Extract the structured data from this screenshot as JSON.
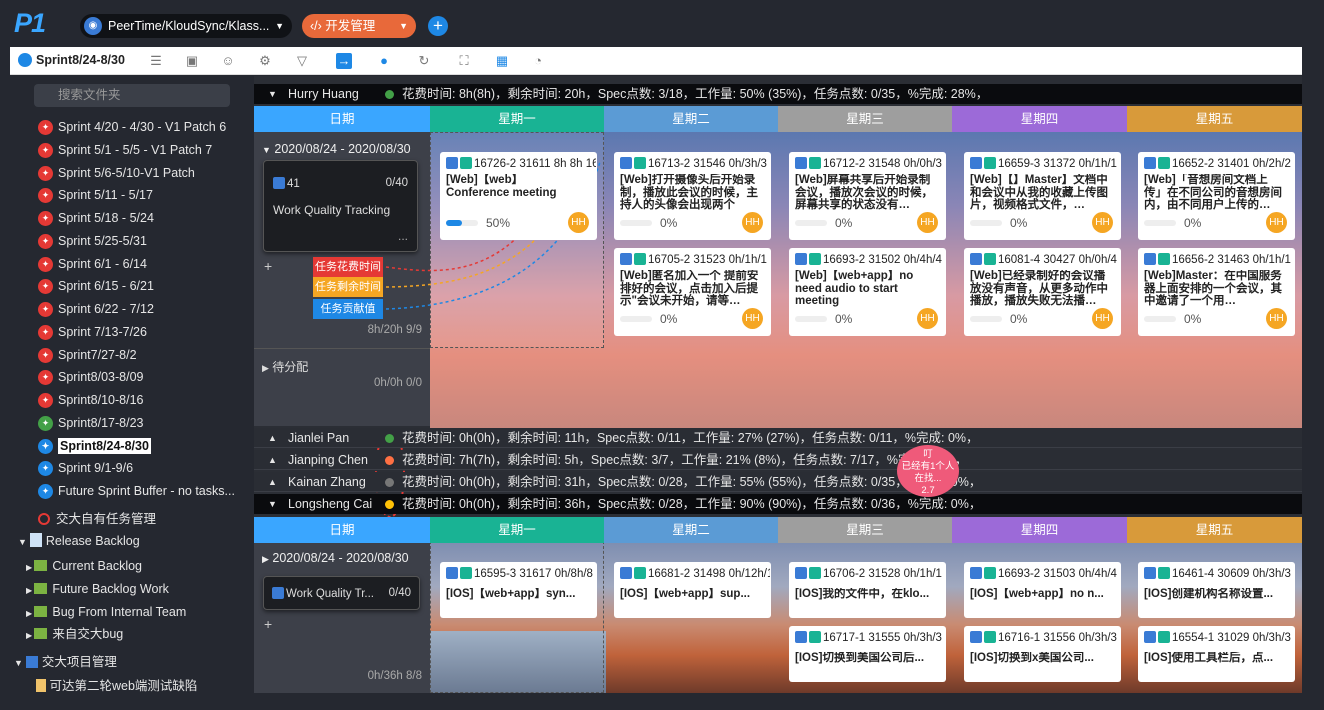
{
  "app": {
    "logo": "P1",
    "project": "PeerTime/KloudSync/Klass...",
    "module": "开发管理"
  },
  "toolbar": {
    "sprint": "Sprint8/24-8/30"
  },
  "sidebar": {
    "search_placeholder": "搜索文件夹",
    "sprints": [
      "Sprint 4/20 - 4/30 - V1 Patch 6",
      "Sprint 5/1 - 5/5 - V1 Patch 7",
      "Sprint 5/6-5/10-V1 Patch",
      "Sprint 5/11 - 5/17",
      "Sprint 5/18 - 5/24",
      "Sprint 5/25-5/31",
      "Sprint 6/1 - 6/14",
      "Sprint 6/15 - 6/21",
      "Sprint 6/22 - 7/12",
      "Sprint 7/13-7/26",
      "Sprint7/27-8/2",
      "Sprint8/03-8/09",
      "Sprint8/10-8/16",
      "Sprint8/17-8/23",
      "Sprint8/24-8/30",
      "Sprint 9/1-9/6",
      "Future Sprint Buffer - no tasks..."
    ],
    "own_tasks": "交大自有任务管理",
    "release_backlog": "Release Backlog",
    "backlog_items": [
      "Current Backlog",
      "Future Backlog Work",
      "Bug From Internal Team",
      "来自交大bug"
    ],
    "project_mgmt": "交大项目管理",
    "doc_item": "可达第二轮web端测试缺陷"
  },
  "users": [
    {
      "name": "Hurry Huang",
      "stats": "花费时间: 8h(8h)，剩余时间: 20h，Spec点数: 3/18，工作量: 50% (35%)，任务点数: 0/35，%完成: 28%，"
    },
    {
      "name": "Jianlei Pan",
      "stats": "花费时间: 0h(0h)，剩余时间: 11h，Spec点数: 0/11，工作量: 27% (27%)，任务点数: 0/11，%完成: 0%，"
    },
    {
      "name": "Jianping Chen",
      "stats": "花费时间: 7h(7h)，剩余时间: 5h，Spec点数: 3/7，工作量: 21% (8%)，任务点数: 7/17，%完成: 41%，"
    },
    {
      "name": "Kainan Zhang",
      "stats": "花费时间: 0h(0h)，剩余时间: 31h，Spec点数: 0/28，工作量: 55% (55%)，任务点数: 0/35，%完成: 0%，"
    },
    {
      "name": "Longsheng Cai",
      "stats": "花费时间: 0h(0h)，剩余时间: 36h，Spec点数: 0/28，工作量: 90% (90%)，任务点数: 0/36，%完成: 0%，"
    }
  ],
  "days": [
    "日期",
    "星期一",
    "星期二",
    "星期三",
    "星期四",
    "星期五"
  ],
  "group1": {
    "range": "2020/08/24 - 2020/08/30",
    "quality": {
      "id": "41",
      "count": "0/40",
      "title": "Work Quality Tracking",
      "more": "..."
    },
    "footer": "8h/20h  9/9",
    "unassigned": "待分配",
    "unassigned_footer": "0h/0h  0/0"
  },
  "tags": [
    "任务花费时间",
    "任务剩余时间",
    "任务贡献值"
  ],
  "cards1": [
    {
      "hd": "16726-2 31611 8h 8h 16",
      "ti": "[Web]【web】Conference meeting",
      "pc": "50%"
    },
    {
      "hd": "16713-2 31546 0h/3h/3",
      "ti": "[Web]打开摄像头后开始录制，播放此会议的时候，主持人的头像会出现两个",
      "pc": "0%"
    },
    {
      "hd": "16712-2 31548 0h/0h/3",
      "ti": "[Web]屏幕共享后开始录制会议，播放次会议的时候，屏幕共享的状态没有…",
      "pc": "0%"
    },
    {
      "hd": "16659-3 31372 0h/1h/1",
      "ti": "[Web]【】Master】文档中和会议中从我的收藏上传图片，视频格式文件，…",
      "pc": "0%"
    },
    {
      "hd": "16652-2 31401 0h/2h/2",
      "ti": "[Web]「音想房间文档上传」在不同公司的音想房间内，由不同用户上传的…",
      "pc": "0%"
    },
    {
      "hd": "16705-2 31523 0h/1h/1",
      "ti": "[Web]匿名加入一个 提前安排好的会议，点击加入后提示\"会议未开始，请等…",
      "pc": "0%"
    },
    {
      "hd": "16693-2 31502 0h/4h/4",
      "ti": "[Web]【web+app】no need audio to start meeting",
      "pc": "0%"
    },
    {
      "hd": "16081-4 30427 0h/0h/4",
      "ti": "[Web]已经录制好的会议播放没有声音，从更多动作中播放，播放失败无法播…",
      "pc": "0%"
    },
    {
      "hd": "16656-2 31463 0h/1h/1",
      "ti": "[Web]Master：在中国服务器上面安排的一个会议，其中邀请了一个用…",
      "pc": "0%"
    }
  ],
  "assignee_initials": "HH",
  "group2": {
    "range": "2020/08/24 - 2020/08/30",
    "quality": {
      "title": "Work Quality Tr...",
      "count": "0/40"
    },
    "footer": "0h/36h  8/8"
  },
  "cards2": [
    {
      "hd": "16595-3 31617 0h/8h/8",
      "ti": "[IOS]【web+app】syn..."
    },
    {
      "hd": "16681-2 31498 0h/12h/12",
      "ti": "[IOS]【web+app】sup..."
    },
    {
      "hd": "16706-2 31528 0h/1h/1",
      "ti": "[IOS]我的文件中，在klo..."
    },
    {
      "hd": "16693-2 31503 0h/4h/4",
      "ti": "[IOS]【web+app】no n..."
    },
    {
      "hd": "16461-4 30609 0h/3h/3",
      "ti": "[IOS]创建机构名称设置..."
    },
    {
      "hd": "16717-1 31555 0h/3h/3",
      "ti": "[IOS]切换到美国公司后..."
    },
    {
      "hd": "16716-1 31556 0h/3h/3",
      "ti": "[IOS]切换到x美国公司..."
    },
    {
      "hd": "16554-1 31029 0h/3h/3",
      "ti": "[IOS]使用工具栏后，点..."
    }
  ],
  "bubble": {
    "title": "叮",
    "text": "已经有1个人在找...",
    "num": "2.7"
  },
  "colors": {
    "accent": "#1e88e5",
    "orange": "#e8693a",
    "cyan": "#19b394"
  }
}
